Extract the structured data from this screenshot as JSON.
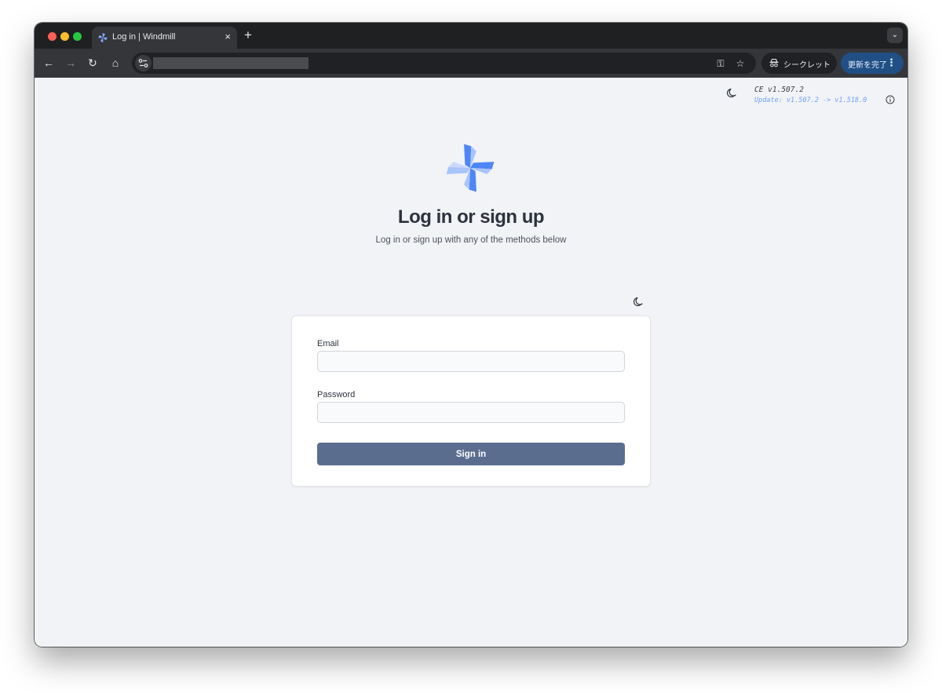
{
  "browser": {
    "tab": {
      "title": "Log in | Windmill",
      "close": "×"
    },
    "new_tab": "+",
    "tab_menu": "⌄",
    "toolbar": {
      "back": "←",
      "forward": "→",
      "reload": "↻",
      "home": "⌂",
      "key": "⚿",
      "bookmark": "☆",
      "incognito_label": "シークレット",
      "update_label": "更新を完了",
      "menu": "⋮"
    }
  },
  "page": {
    "version": "CE v1.507.2",
    "update_notice": "Update: v1.507.2 -> v1.518.0",
    "heading": "Log in or sign up",
    "subheading": "Log in or sign up with any of the methods below",
    "form": {
      "email_label": "Email",
      "email_value": "",
      "password_label": "Password",
      "password_value": "",
      "submit_label": "Sign in"
    }
  },
  "colors": {
    "accent": "#5b6d8f",
    "logo_blue": "#4f86f7",
    "logo_light": "#a9c4fb",
    "update_link": "#6ea0ff"
  }
}
